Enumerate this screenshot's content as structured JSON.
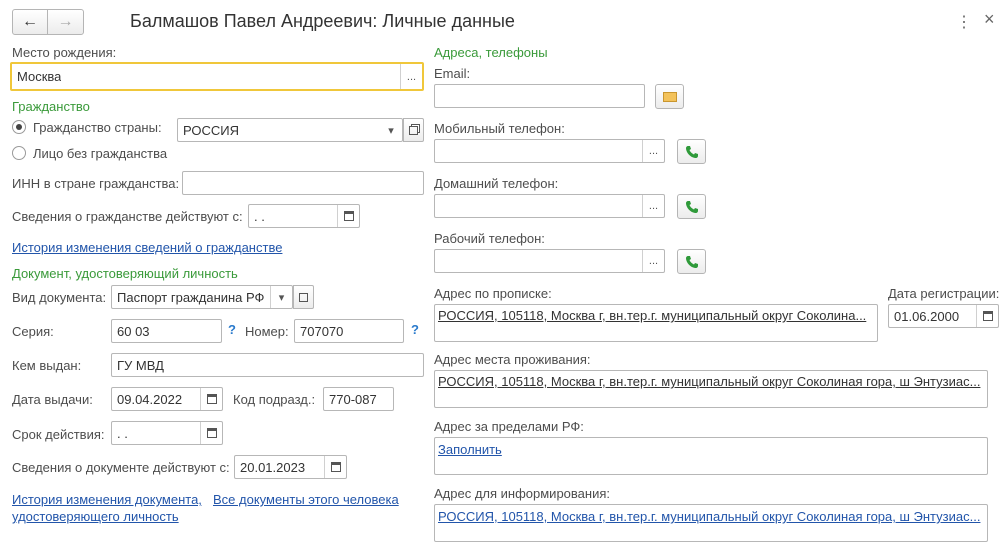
{
  "window": {
    "title": "Балмашов Павел Андреевич: Личные данные",
    "nav_back": "←",
    "nav_forward": "→",
    "menu_icon": "⋮",
    "close_icon": "×"
  },
  "birth": {
    "label": "Место рождения:",
    "value": "Москва"
  },
  "citizenship": {
    "header": "Гражданство",
    "country_radio_label": "Гражданство страны:",
    "country_value": "РОССИЯ",
    "stateless_label": "Лицо без гражданства",
    "inn_label": "ИНН в стране гражданства:",
    "inn_value": "",
    "valid_label": "Сведения о гражданстве действуют с:",
    "valid_value": " .  .",
    "history_link": "История изменения сведений о гражданстве"
  },
  "document": {
    "header": "Документ, удостоверяющий личность",
    "type_label": "Вид документа:",
    "type_value": "Паспорт гражданина РФ",
    "series_label": "Серия:",
    "series_value": "60 03",
    "number_label": "Номер:",
    "number_value": "707070",
    "issued_by_label": "Кем выдан:",
    "issued_by_value": "ГУ МВД",
    "issue_date_label": "Дата выдачи:",
    "issue_date_value": "09.04.2022",
    "dept_code_label": "Код подразд.:",
    "dept_code_value": "770-087",
    "expiry_label": "Срок действия:",
    "expiry_value": " .  .",
    "valid_label": "Сведения о документе действуют с:",
    "valid_value": "20.01.2023",
    "history_link_line1": "История изменения документа,",
    "history_link_line2": "удостоверяющего личность",
    "all_docs_link": "Все документы этого человека",
    "question_mark": "?"
  },
  "contacts": {
    "header": "Адреса, телефоны",
    "email_label": "Email:",
    "email_value": "",
    "mobile_label": "Мобильный телефон:",
    "mobile_value": "",
    "home_label": "Домашний телефон:",
    "home_value": "",
    "work_label": "Рабочий телефон:",
    "work_value": ""
  },
  "addresses": {
    "registration_label": "Адрес по прописке:",
    "registration_value": "РОССИЯ, 105118, Москва г, вн.тер.г. муниципальный округ Соколина...",
    "reg_date_label": "Дата регистрации:",
    "reg_date_value": "01.06.2000",
    "residence_label": "Адрес места проживания:",
    "residence_value": "РОССИЯ, 105118, Москва г, вн.тер.г. муниципальный округ Соколиная гора, ш Энтузиас...",
    "abroad_label": "Адрес за пределами РФ:",
    "abroad_value": "Заполнить",
    "info_label": "Адрес для информирования:",
    "info_value": "РОССИЯ, 105118, Москва г, вн.тер.г. муниципальный округ Соколиная гора, ш Энтузиас..."
  },
  "icons": {
    "ellipsis": "...",
    "dropdown": "▾"
  }
}
